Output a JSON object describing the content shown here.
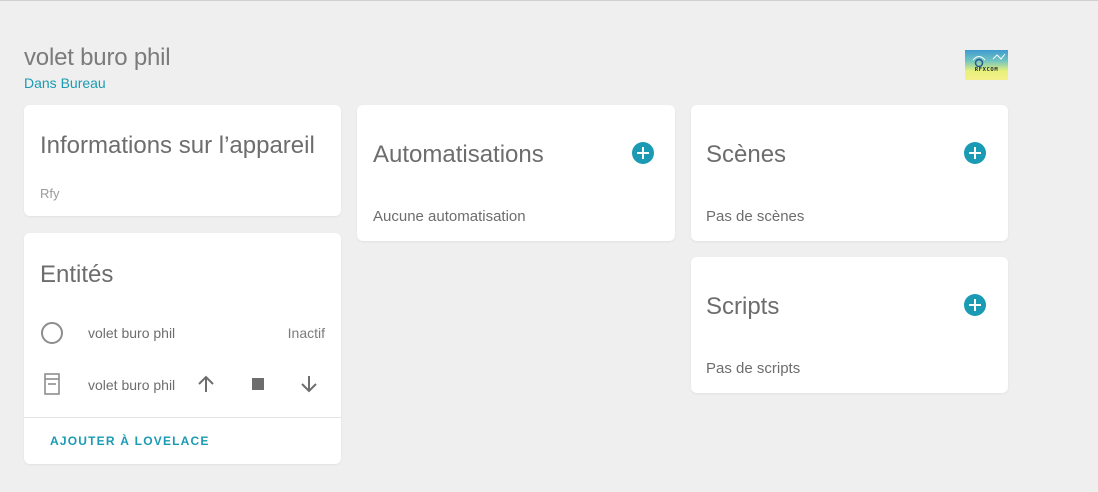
{
  "device": {
    "name": "volet buro phil",
    "area": "Dans Bureau",
    "logo_text": "RFXCOM"
  },
  "info_card": {
    "title": "Informations sur l’appareil",
    "model": "Rfy"
  },
  "entities_card": {
    "title": "Entités",
    "rows": [
      {
        "name": "volet buro phil",
        "state": "Inactif",
        "icon": "circle-outline-icon"
      },
      {
        "name": "volet buro phil",
        "icon": "window-shutter-icon",
        "controls": [
          "arrow-up-icon",
          "stop-icon",
          "arrow-down-icon"
        ]
      }
    ],
    "action_label": "AJOUTER À LOVELACE"
  },
  "automations_card": {
    "title": "Automatisations",
    "empty_text": "Aucune automatisation"
  },
  "scenes_card": {
    "title": "Scènes",
    "empty_text": "Pas de scènes"
  },
  "scripts_card": {
    "title": "Scripts",
    "empty_text": "Pas de scripts"
  },
  "colors": {
    "accent": "#1a9bb3",
    "background": "#efefef",
    "card": "#ffffff"
  }
}
